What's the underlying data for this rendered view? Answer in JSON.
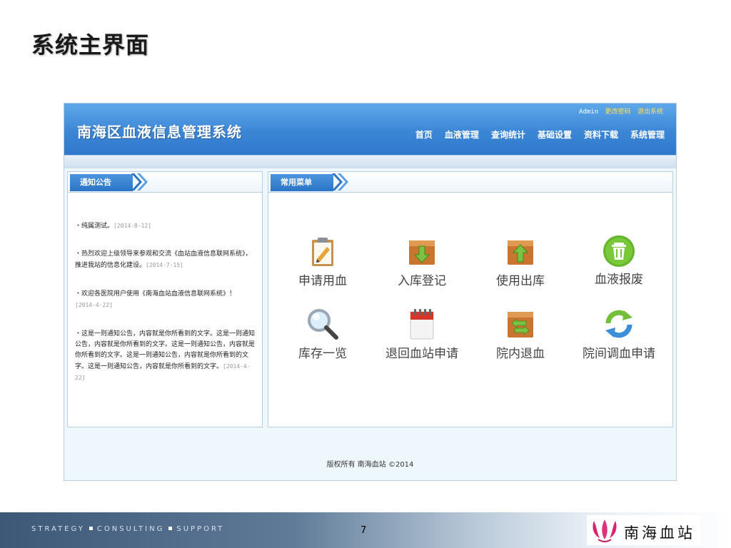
{
  "slide": {
    "title": "系统主界面",
    "tagline": [
      "STRATEGY",
      "CONSULTING",
      "SUPPORT"
    ],
    "page_number": "7",
    "logo_text": "南海血站"
  },
  "app": {
    "title": "南海区血液信息管理系统",
    "topbar": {
      "user": "Admin",
      "change_password": "更改密码",
      "logout": "退出系统"
    },
    "nav": [
      "首页",
      "血液管理",
      "查询统计",
      "基础设置",
      "资料下载",
      "系统管理"
    ],
    "notice_panel": {
      "title": "通知公告",
      "items": [
        {
          "text": "・纯属测试。",
          "date": "[2014-8-12]"
        },
        {
          "text": "・热烈欢迎上级领导来参观和交流《血站血液信息联网系统》，推进我站的信息化建设。",
          "date": "[2014-7-15]"
        },
        {
          "text": "・欢迎各医院用户使用《南海血站血液信息联网系统》！",
          "date": "[2014-4-22]"
        },
        {
          "text": "・这是一则通知公告，内容就是你所看到的文字。这是一则通知公告，内容就是你所看到的文字。这是一则通知公告，内容就是你所看到的文字。这是一则通知公告，内容就是你所看到的文字。这是一则通知公告，内容就是你所看到的文字。",
          "date": "[2014-4-22]"
        }
      ]
    },
    "menu_panel": {
      "title": "常用菜单",
      "items": [
        {
          "label": "申请用血",
          "icon": "clipboard-pencil-icon"
        },
        {
          "label": "入库登记",
          "icon": "box-down-arrow-icon"
        },
        {
          "label": "使用出库",
          "icon": "box-up-arrow-icon"
        },
        {
          "label": "血液报废",
          "icon": "trash-can-icon"
        },
        {
          "label": "库存一览",
          "icon": "magnifier-icon"
        },
        {
          "label": "退回血站申请",
          "icon": "calendar-icon"
        },
        {
          "label": "院内退血",
          "icon": "box-swap-arrows-icon"
        },
        {
          "label": "院间调血申请",
          "icon": "refresh-arrows-icon"
        }
      ]
    },
    "footer": "版权所有 南海血站 ©2014"
  }
}
